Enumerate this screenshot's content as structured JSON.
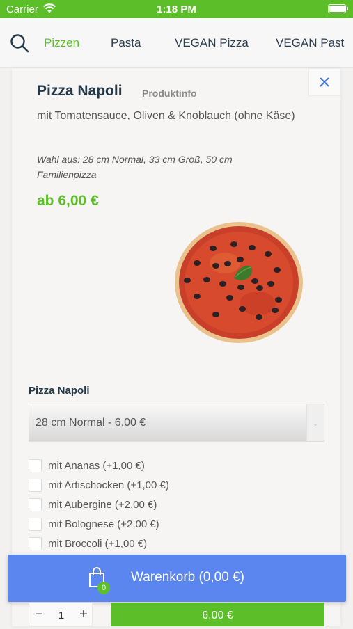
{
  "status_bar": {
    "carrier": "Carrier",
    "time": "1:18 PM"
  },
  "nav": {
    "tabs": [
      {
        "label": "Pizzen",
        "active": true
      },
      {
        "label": "Pasta",
        "active": false
      },
      {
        "label": "VEGAN Pizza",
        "active": false
      },
      {
        "label": "VEGAN Past",
        "active": false
      }
    ]
  },
  "product": {
    "title": "Pizza Napoli",
    "info_link": "Produktinfo",
    "description": "mit Tomatensauce, Oliven & Knoblauch (ohne Käse)",
    "choice_text": "Wahl aus: 28 cm Normal, 33 cm Groß, 50 cm Familienpizza",
    "price": "ab 6,00 €",
    "variant_label": "Pizza Napoli",
    "selected_variant": "28 cm Normal - 6,00 €"
  },
  "extras": [
    {
      "label": "mit Ananas (+1,00 €)",
      "checked": false
    },
    {
      "label": "mit Artischocken (+1,00 €)",
      "checked": false
    },
    {
      "label": "mit Aubergine (+2,00 €)",
      "checked": false
    },
    {
      "label": "mit Bolognese (+2,00 €)",
      "checked": false
    },
    {
      "label": "mit Broccoli (+1,00 €)",
      "checked": false
    }
  ],
  "cart": {
    "label": "Warenkorb (0,00 €)",
    "count": "0"
  },
  "order": {
    "quantity": "1",
    "minus": "−",
    "plus": "+",
    "add_label": "6,00 €"
  },
  "colors": {
    "accent_green": "#5cbf2a",
    "cart_blue": "#5b86ef",
    "title_navy": "#23394a"
  },
  "icons": {
    "search": "search-icon",
    "close": "close-icon",
    "cart": "shopping-bag-icon",
    "wifi": "wifi-icon",
    "battery": "battery-icon"
  }
}
